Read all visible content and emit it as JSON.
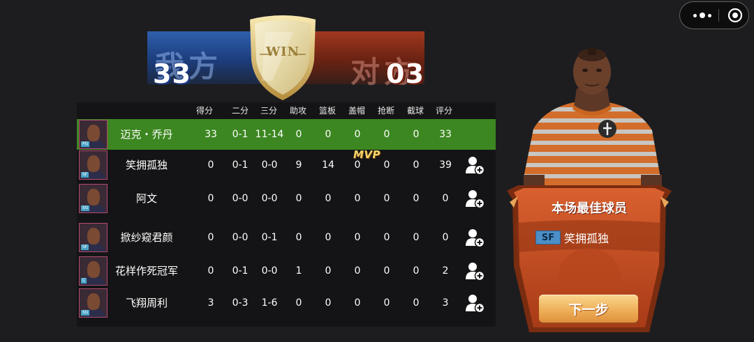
{
  "capsule": {
    "more_icon": "more-dots-icon",
    "close_icon": "target-circle-icon"
  },
  "scoreboard": {
    "left_team_label": "我方",
    "left_score": "33",
    "right_team_label": "对方",
    "right_score": "03",
    "result_label": "WIN",
    "left_color": "#2f5fad",
    "right_color": "#a0381f",
    "shield_color": "#e9dfb4"
  },
  "table": {
    "headers": [
      "得分",
      "二分",
      "三分",
      "助攻",
      "篮板",
      "盖帽",
      "抢断",
      "截球",
      "评分"
    ],
    "highlight_color": "#3c8721",
    "rows": [
      {
        "name": "迈克・乔丹",
        "position": "PG",
        "stats": [
          "33",
          "0-1",
          "11-14",
          "0",
          "0",
          "0",
          "0",
          "0",
          "33"
        ],
        "highlight": true,
        "add_friend": false
      },
      {
        "name": "笑拥孤独",
        "position": "SF",
        "stats": [
          "0",
          "0-1",
          "0-0",
          "9",
          "14",
          "0",
          "0",
          "0",
          "39"
        ],
        "highlight": false,
        "add_friend": true,
        "mvp": "MVP"
      },
      {
        "name": "阿文",
        "position": "SG",
        "stats": [
          "0",
          "0-0",
          "0-0",
          "0",
          "0",
          "0",
          "0",
          "0",
          "0"
        ],
        "highlight": false,
        "add_friend": true
      },
      {
        "name": "掀纱窥君颜",
        "position": "SF",
        "stats": [
          "0",
          "0-0",
          "0-1",
          "0",
          "0",
          "0",
          "0",
          "0",
          "0"
        ],
        "highlight": false,
        "add_friend": true
      },
      {
        "name": "花样作死冠军",
        "position": "C",
        "stats": [
          "0",
          "0-1",
          "0-0",
          "1",
          "0",
          "0",
          "0",
          "0",
          "2"
        ],
        "highlight": false,
        "add_friend": true
      },
      {
        "name": "飞翔周利",
        "position": "SG",
        "stats": [
          "3",
          "0-3",
          "1-6",
          "0",
          "0",
          "0",
          "0",
          "0",
          "3"
        ],
        "highlight": false,
        "add_friend": true
      }
    ]
  },
  "mvp_panel": {
    "title": "本场最佳球员",
    "position": "SF",
    "player_name": "笑拥孤独",
    "next_button": "下一步",
    "banner_color": "#c9542a",
    "button_color": "#f0b45e"
  }
}
